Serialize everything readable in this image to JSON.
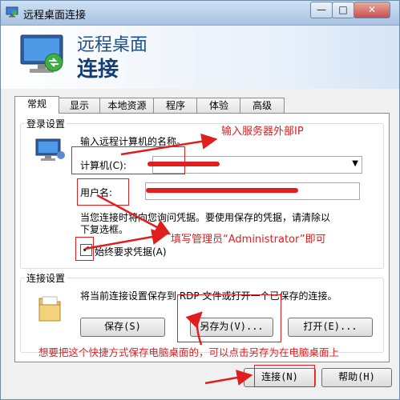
{
  "window": {
    "title": "远程桌面连接",
    "controls": {
      "minimize": "—",
      "maximize": "□",
      "close": "✕"
    }
  },
  "banner": {
    "line1": "远程桌面",
    "line2": "连接"
  },
  "tabs": [
    "常规",
    "显示",
    "本地资源",
    "程序",
    "体验",
    "高级"
  ],
  "login_settings": {
    "title": "登录设置",
    "prompt": "输入远程计算机的名称。",
    "computer_label": "计算机(C):",
    "username_label": "用户名:",
    "info_line1": "当您连接时将向您询问凭据。要使用保存的凭据，请清除以",
    "info_line2": "下复选框。",
    "always_ask_label": "始终要求凭据(A)",
    "always_ask_checked": true
  },
  "connection_settings": {
    "title": "连接设置",
    "description": "将当前连接设置保存到 RDP 文件或打开一个已保存的连接。",
    "save_button": "保存(S)",
    "save_as_button": "另存为(V)...",
    "open_button": "打开(E)..."
  },
  "footer": {
    "connect_button": "连接(N)",
    "help_button": "帮助(H)"
  },
  "annotations": {
    "server_ip": "输入服务器外部IP",
    "admin_user": "填写管理员“Administrator”即可",
    "save_shortcut": "想要把这个快捷方式保存电脑桌面的，可以点击另存为在电脑桌面上"
  },
  "colors": {
    "annotation": "#e01e1e",
    "banner_text": "#1f4f8c",
    "title_bar": "#a8c3e2"
  },
  "icons": [
    "remote-desktop-app-icon",
    "monitor-icon",
    "user-computer-icon",
    "folder-icon",
    "dropdown-arrow-icon",
    "check-icon"
  ]
}
